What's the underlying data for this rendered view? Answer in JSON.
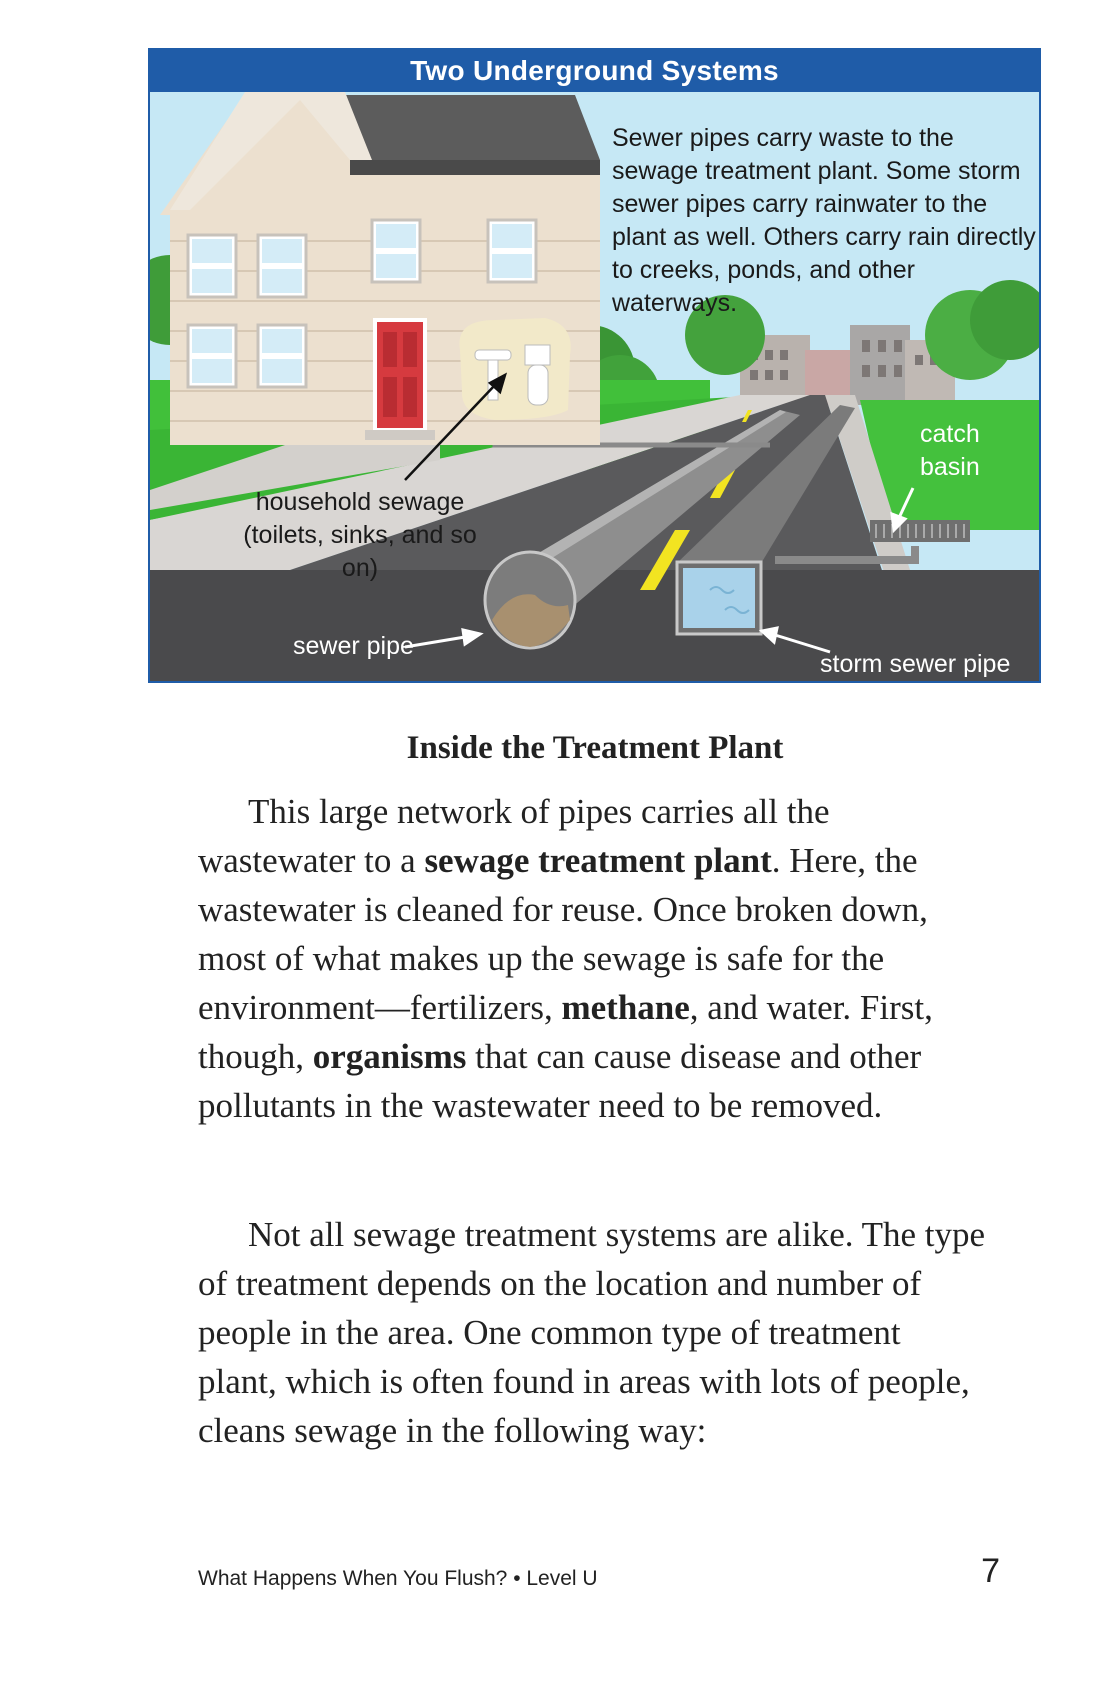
{
  "figure": {
    "title": "Two Underground Systems",
    "callouts": {
      "storm_note_lines": [
        "Sewer pipes carry waste to the",
        "sewage treatment plant. Some storm",
        "sewer pipes carry rainwater to the",
        "plant as well. Others carry rain directly",
        "to creeks, ponds, and other",
        "waterways."
      ],
      "household_sewage_line1": "household sewage",
      "household_sewage_line2": "(toilets, sinks, and so on)",
      "catch_basin_line1": "catch",
      "catch_basin_line2": "basin",
      "sewer_pipe": "sewer pipe",
      "storm_sewer_pipe": "storm sewer pipe"
    }
  },
  "article": {
    "heading": "Inside the Treatment Plant",
    "para1": {
      "t1": "This large network of pipes carries all the wastewater to a ",
      "b1": "sewage treatment plant",
      "t2": ". Here, the wastewater is cleaned for reuse. Once broken down, most of what makes up the sewage is safe for the environment—fertilizers, ",
      "b2": "methane",
      "t3": ", and water. First, though, ",
      "b3": "organisms",
      "t4": " that can cause disease and other pollutants in the wastewater need to be removed."
    },
    "para2": "Not all sewage treatment systems are alike. The type of treatment depends on the location and number of people in the area. One common type of treatment plant, which is often found in areas with lots of people, cleans sewage in the following way:"
  },
  "footer": {
    "book_title": "What Happens When You Flush? • Level U",
    "page_number": "7"
  },
  "colors": {
    "title_bar": "#1f5ca8",
    "sky": "#bfe3f2",
    "grass": "#3fbf3a",
    "road": "#4a4a4c",
    "lane_marking": "#f2e421"
  }
}
